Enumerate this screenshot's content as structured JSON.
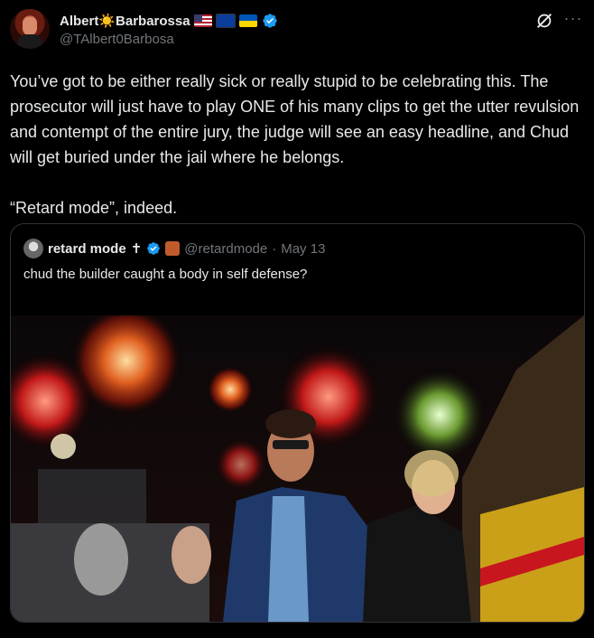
{
  "author": {
    "name": "Albert☀️Barbarossa",
    "handle": "@TAlbert0Barbosa",
    "flags": [
      "us-flag",
      "eu-flag",
      "ukraine-flag"
    ],
    "verified": true
  },
  "tweet": {
    "text": "You’ve got to be either really sick or really stupid to be celebrating this. The prosecutor will just have to play ONE of his many clips to get the utter revulsion and contempt of the entire jury, the judge will see an easy headline, and Chud will get buried under the jail where he belongs.\n\n“Retard mode”, indeed."
  },
  "quoted": {
    "name": "retard mode",
    "name_symbol": "✝",
    "handle": "@retardmode",
    "separator": "·",
    "date": "May 13",
    "text": "chud the builder caught a body in self defense?",
    "media": "image-fireworks-celebration",
    "verified": true
  },
  "icons": {
    "grok": "grok-icon",
    "more": "more-icon"
  },
  "colors": {
    "background": "#000000",
    "text": "#e7e9ea",
    "secondary": "#71767b",
    "verified": "#1d9bf0",
    "border": "#2f3336"
  }
}
